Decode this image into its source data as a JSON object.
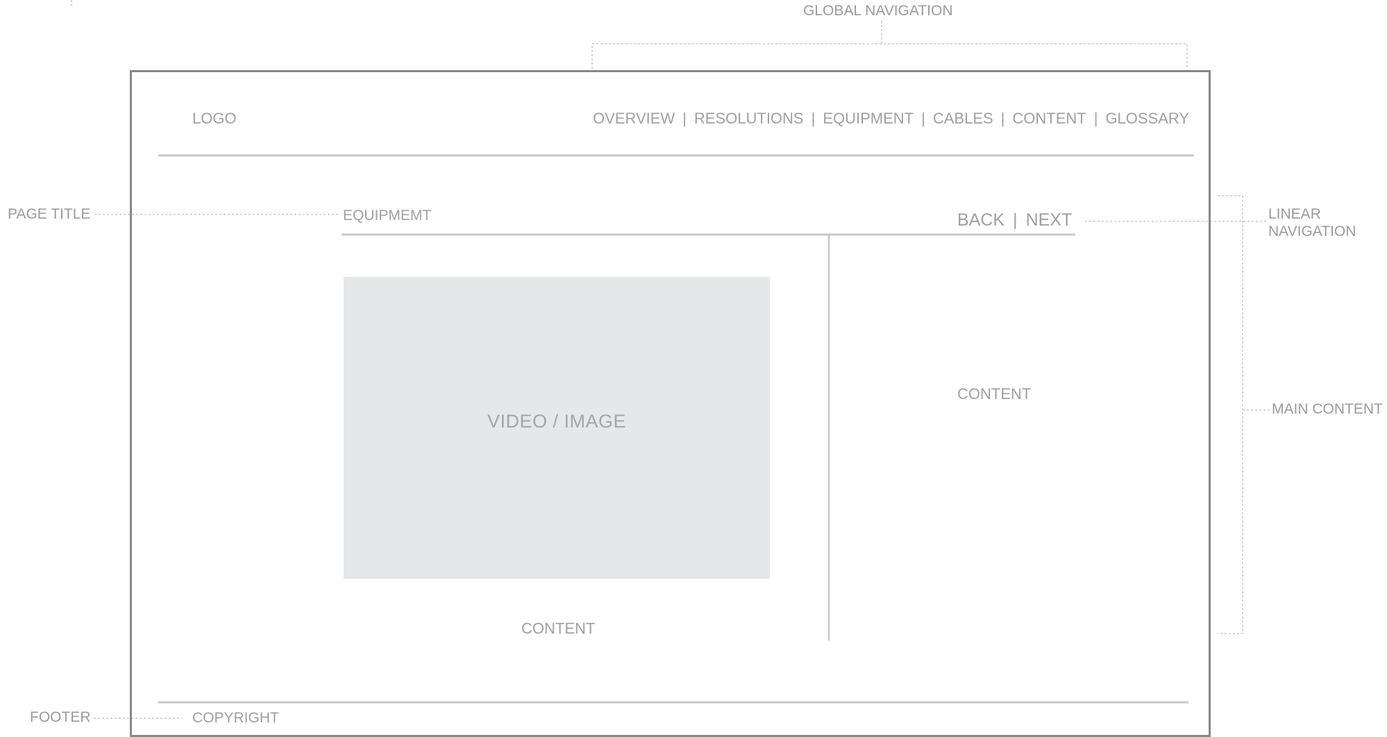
{
  "annotations": {
    "global_navigation": "GLOBAL NAVIGATION",
    "page_title": "PAGE TITLE",
    "linear_navigation_line1": "LINEAR",
    "linear_navigation_line2": "NAVIGATION",
    "main_content": "MAIN CONTENT",
    "footer": "FOOTER"
  },
  "header": {
    "logo": "LOGO",
    "nav_items": [
      "OVERVIEW",
      "RESOLUTIONS",
      "EQUIPMENT",
      "CABLES",
      "CONTENT",
      "GLOSSARY"
    ],
    "separator": "|"
  },
  "page": {
    "title": "EQUIPMEMT",
    "back_label": "BACK",
    "next_label": "NEXT"
  },
  "main": {
    "media_label": "VIDEO / IMAGE",
    "left_content": "CONTENT",
    "right_content": "CONTENT"
  },
  "footer": {
    "copyright": "COPYRIGHT"
  },
  "colors": {
    "frame": "#878787",
    "rule": "#c8c8c8",
    "placeholder": "#e6e7e8",
    "text": "#a0a0a0",
    "callout": "#bdbdbd"
  }
}
